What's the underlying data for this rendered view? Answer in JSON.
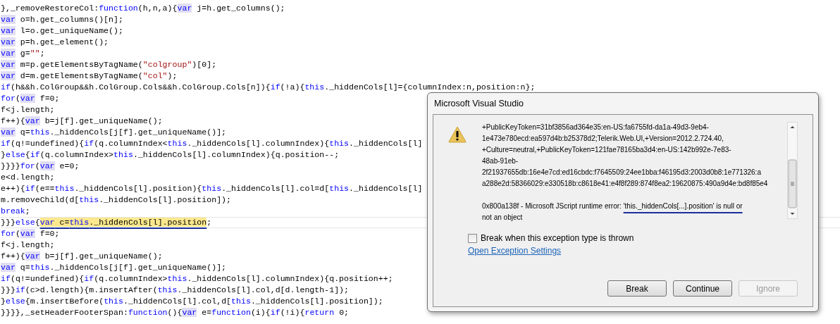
{
  "editor": {
    "lines": [
      {
        "current": false,
        "segments": [
          {
            "text": "},_removeRestoreCol:",
            "kind": "plain"
          },
          {
            "text": "function",
            "kind": "kw"
          },
          {
            "text": "(h,n,a){",
            "kind": "plain"
          },
          {
            "text": "var",
            "kind": "ref"
          },
          {
            "text": " j=h.get_columns();",
            "kind": "plain"
          }
        ]
      },
      {
        "current": false,
        "segments": [
          {
            "text": "var",
            "kind": "ref"
          },
          {
            "text": " o=h.get_columns()[n];",
            "kind": "plain"
          }
        ]
      },
      {
        "current": false,
        "segments": [
          {
            "text": "var",
            "kind": "ref"
          },
          {
            "text": " l=o.get_uniqueName();",
            "kind": "plain"
          }
        ]
      },
      {
        "current": false,
        "segments": [
          {
            "text": "var",
            "kind": "ref"
          },
          {
            "text": " p=h.get_element();",
            "kind": "plain"
          }
        ]
      },
      {
        "current": false,
        "segments": [
          {
            "text": "var",
            "kind": "ref"
          },
          {
            "text": " g=",
            "kind": "plain"
          },
          {
            "text": "\"\"",
            "kind": "str"
          },
          {
            "text": ";",
            "kind": "plain"
          }
        ]
      },
      {
        "current": false,
        "segments": [
          {
            "text": "var",
            "kind": "ref"
          },
          {
            "text": " m=p.getElementsByTagName(",
            "kind": "plain"
          },
          {
            "text": "\"colgroup\"",
            "kind": "str"
          },
          {
            "text": ")[0];",
            "kind": "plain"
          }
        ]
      },
      {
        "current": false,
        "segments": [
          {
            "text": "var",
            "kind": "ref"
          },
          {
            "text": " d=m.getElementsByTagName(",
            "kind": "plain"
          },
          {
            "text": "\"col\"",
            "kind": "str"
          },
          {
            "text": ");",
            "kind": "plain"
          }
        ]
      },
      {
        "current": false,
        "segments": [
          {
            "text": "if",
            "kind": "kw"
          },
          {
            "text": "(h&&h.ColGroup&&h.ColGroup.Cols&&h.ColGroup.Cols[n]){",
            "kind": "plain"
          },
          {
            "text": "if",
            "kind": "kw"
          },
          {
            "text": "(!a){",
            "kind": "plain"
          },
          {
            "text": "this",
            "kind": "kw"
          },
          {
            "text": "._hiddenCols[l]={columnIndex:n,position:n};",
            "kind": "plain"
          }
        ]
      },
      {
        "current": false,
        "segments": [
          {
            "text": "for",
            "kind": "kw"
          },
          {
            "text": "(",
            "kind": "plain"
          },
          {
            "text": "var",
            "kind": "ref"
          },
          {
            "text": " f=0;",
            "kind": "plain"
          }
        ]
      },
      {
        "current": false,
        "segments": [
          {
            "text": "f<j.length;",
            "kind": "plain"
          }
        ]
      },
      {
        "current": false,
        "segments": [
          {
            "text": "f++){",
            "kind": "plain"
          },
          {
            "text": "var",
            "kind": "ref"
          },
          {
            "text": " b=j[f].get_uniqueName();",
            "kind": "plain"
          }
        ]
      },
      {
        "current": false,
        "segments": [
          {
            "text": "var",
            "kind": "ref"
          },
          {
            "text": " q=",
            "kind": "plain"
          },
          {
            "text": "this",
            "kind": "kw"
          },
          {
            "text": "._hiddenCols[j[f].get_uniqueName()];",
            "kind": "plain"
          }
        ]
      },
      {
        "current": false,
        "segments": [
          {
            "text": "if",
            "kind": "kw"
          },
          {
            "text": "(q!=undefined){",
            "kind": "plain"
          },
          {
            "text": "if",
            "kind": "kw"
          },
          {
            "text": "(q.columnIndex<",
            "kind": "plain"
          },
          {
            "text": "this",
            "kind": "kw"
          },
          {
            "text": "._hiddenCols[l].columnIndex){",
            "kind": "plain"
          },
          {
            "text": "this",
            "kind": "kw"
          },
          {
            "text": "._hiddenCols[l]",
            "kind": "plain"
          }
        ]
      },
      {
        "current": false,
        "segments": [
          {
            "text": "}",
            "kind": "plain"
          },
          {
            "text": "else",
            "kind": "kw"
          },
          {
            "text": "{",
            "kind": "plain"
          },
          {
            "text": "if",
            "kind": "kw"
          },
          {
            "text": "(q.columnIndex>",
            "kind": "plain"
          },
          {
            "text": "this",
            "kind": "kw"
          },
          {
            "text": "._hiddenCols[l].columnIndex){q.position--;",
            "kind": "plain"
          }
        ]
      },
      {
        "current": false,
        "segments": [
          {
            "text": "}}}}",
            "kind": "plain"
          },
          {
            "text": "for",
            "kind": "kw"
          },
          {
            "text": "(",
            "kind": "plain"
          },
          {
            "text": "var",
            "kind": "ref"
          },
          {
            "text": " e=0;",
            "kind": "plain"
          }
        ]
      },
      {
        "current": false,
        "segments": [
          {
            "text": "e<d.length;",
            "kind": "plain"
          }
        ]
      },
      {
        "current": false,
        "segments": [
          {
            "text": "e++){",
            "kind": "plain"
          },
          {
            "text": "if",
            "kind": "kw"
          },
          {
            "text": "(e==",
            "kind": "plain"
          },
          {
            "text": "this",
            "kind": "kw"
          },
          {
            "text": "._hiddenCols[l].position){",
            "kind": "plain"
          },
          {
            "text": "this",
            "kind": "kw"
          },
          {
            "text": "._hiddenCols[l].col=d[",
            "kind": "plain"
          },
          {
            "text": "this",
            "kind": "kw"
          },
          {
            "text": "._hiddenCols[l]",
            "kind": "plain"
          }
        ]
      },
      {
        "current": false,
        "segments": [
          {
            "text": "m.removeChild(d[",
            "kind": "plain"
          },
          {
            "text": "this",
            "kind": "kw"
          },
          {
            "text": "._hiddenCols[l].position]);",
            "kind": "plain"
          }
        ]
      },
      {
        "current": false,
        "segments": [
          {
            "text": "break",
            "kind": "kw"
          },
          {
            "text": ";",
            "kind": "plain"
          }
        ]
      },
      {
        "current": true,
        "segments": [
          {
            "text": "}}}",
            "kind": "plain"
          },
          {
            "text": "else",
            "kind": "kw"
          },
          {
            "text": "{",
            "kind": "plain"
          },
          {
            "text": "var",
            "kind": "markkw"
          },
          {
            "text": " c=",
            "kind": "mark"
          },
          {
            "text": "this",
            "kind": "markkw"
          },
          {
            "text": "._hiddenCols[l].position",
            "kind": "mark"
          },
          {
            "text": ";",
            "kind": "plain"
          }
        ]
      },
      {
        "current": false,
        "segments": [
          {
            "text": "for",
            "kind": "kw"
          },
          {
            "text": "(",
            "kind": "plain"
          },
          {
            "text": "var",
            "kind": "ref"
          },
          {
            "text": " f=0;",
            "kind": "plain"
          }
        ]
      },
      {
        "current": false,
        "segments": [
          {
            "text": "f<j.length;",
            "kind": "plain"
          }
        ]
      },
      {
        "current": false,
        "segments": [
          {
            "text": "f++){",
            "kind": "plain"
          },
          {
            "text": "var",
            "kind": "ref"
          },
          {
            "text": " b=j[f].get_uniqueName();",
            "kind": "plain"
          }
        ]
      },
      {
        "current": false,
        "segments": [
          {
            "text": "var",
            "kind": "ref"
          },
          {
            "text": " q=",
            "kind": "plain"
          },
          {
            "text": "this",
            "kind": "kw"
          },
          {
            "text": "._hiddenCols[j[f].get_uniqueName()];",
            "kind": "plain"
          }
        ]
      },
      {
        "current": false,
        "segments": [
          {
            "text": "if",
            "kind": "kw"
          },
          {
            "text": "(q!=undefined){",
            "kind": "plain"
          },
          {
            "text": "if",
            "kind": "kw"
          },
          {
            "text": "(q.columnIndex>",
            "kind": "plain"
          },
          {
            "text": "this",
            "kind": "kw"
          },
          {
            "text": "._hiddenCols[l].columnIndex){q.position++;",
            "kind": "plain"
          }
        ]
      },
      {
        "current": false,
        "segments": [
          {
            "text": "}}}",
            "kind": "plain"
          },
          {
            "text": "if",
            "kind": "kw"
          },
          {
            "text": "(c>d.length){m.insertAfter(",
            "kind": "plain"
          },
          {
            "text": "this",
            "kind": "kw"
          },
          {
            "text": "._hiddenCols[l].col,d[d.length-1]);",
            "kind": "plain"
          }
        ]
      },
      {
        "current": false,
        "segments": [
          {
            "text": "}",
            "kind": "plain"
          },
          {
            "text": "else",
            "kind": "kw"
          },
          {
            "text": "{m.insertBefore(",
            "kind": "plain"
          },
          {
            "text": "this",
            "kind": "kw"
          },
          {
            "text": "._hiddenCols[l].col,d[",
            "kind": "plain"
          },
          {
            "text": "this",
            "kind": "kw"
          },
          {
            "text": "._hiddenCols[l].position]);",
            "kind": "plain"
          }
        ]
      },
      {
        "current": false,
        "segments": [
          {
            "text": "}}}},_setHeaderFooterSpan:",
            "kind": "plain"
          },
          {
            "text": "function",
            "kind": "kw"
          },
          {
            "text": "(){",
            "kind": "plain"
          },
          {
            "text": "var",
            "kind": "ref"
          },
          {
            "text": " e=",
            "kind": "plain"
          },
          {
            "text": "function",
            "kind": "kw"
          },
          {
            "text": "(i){",
            "kind": "plain"
          },
          {
            "text": "if",
            "kind": "kw"
          },
          {
            "text": "(!i){",
            "kind": "plain"
          },
          {
            "text": "return",
            "kind": "kw"
          },
          {
            "text": " 0;",
            "kind": "plain"
          }
        ]
      }
    ]
  },
  "dialog": {
    "title": "Microsoft Visual Studio",
    "details": "+PublicKeyToken=31bf3856ad364e35:en-US:fa6755fd-da1a-49d3-9eb4-\n1e473e780ecd:ea597d4b:b25378d2;Telerik.Web.UI,+Version=2012.2.724.40,\n+Culture=neutral,+PublicKeyToken=121fae78165ba3d4:en-US:142b992e-7e83-\n48ab-91eb-\n2f21937655db:16e4e7cd:ed16cbdc:f7645509:24ee1bba:f46195d3:2003d0b8:1e771326:a\na288e2d:58366029:e330518b:c8618e41:e4f8f289:874f8ea2:19620875:490a9d4e:bd8f85e4",
    "error": [
      {
        "text": "0x800a138f - Microsoft JScript runtime error: ",
        "kind": "plain"
      },
      {
        "text": "'this._hiddenCols[...].position' is null or",
        "kind": "inked"
      },
      {
        "text": "\nnot an object",
        "kind": "plain"
      }
    ],
    "checkbox": {
      "label": "Break when this exception type is thrown",
      "checked": false
    },
    "link": "Open Exception Settings",
    "buttons": [
      {
        "label": "Break",
        "disabled": false
      },
      {
        "label": "Continue",
        "disabled": false
      },
      {
        "label": "Ignore",
        "disabled": true
      }
    ]
  }
}
